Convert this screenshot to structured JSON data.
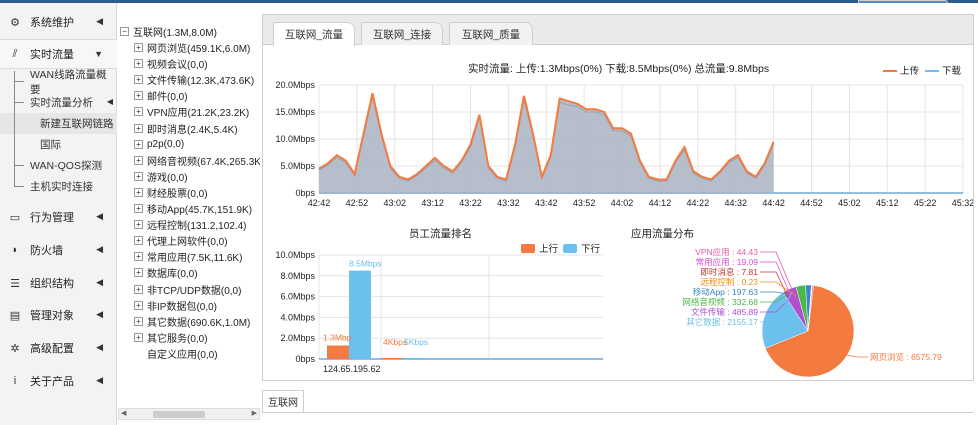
{
  "nav": {
    "items": [
      {
        "label": "系统维护",
        "icon": "dashboard-icon",
        "glyph": "⚙"
      },
      {
        "label": "实时流量",
        "icon": "chart-icon",
        "glyph": "📶"
      },
      {
        "label": "行为管理",
        "icon": "monitor-icon",
        "glyph": "▭"
      },
      {
        "label": "防火墙",
        "icon": "shield-icon",
        "glyph": "◗"
      },
      {
        "label": "组织结构",
        "icon": "list-icon",
        "glyph": "☰"
      },
      {
        "label": "管理对象",
        "icon": "table-icon",
        "glyph": "▤"
      },
      {
        "label": "高级配置",
        "icon": "gears-icon",
        "glyph": "⚙"
      },
      {
        "label": "关于产品",
        "icon": "info-icon",
        "glyph": "ℹ"
      }
    ],
    "subs": [
      "WAN线路流量概要",
      "实时流量分析",
      "新建互联网链路",
      "国际",
      "WAN-QOS探测",
      "主机实时连接"
    ]
  },
  "tree": {
    "root": "互联网(1.3M,8.0M)",
    "children": [
      "网页浏览(459.1K,6.0M)",
      "视频会议(0,0)",
      "文件传输(12.3K,473.6K)",
      "邮件(0,0)",
      "VPN应用(21.2K,23.2K)",
      "即时消息(2.4K,5.4K)",
      "p2p(0,0)",
      "网络音视频(67.4K,265.3K)",
      "游戏(0,0)",
      "财经股票(0,0)",
      "移动App(45.7K,151.9K)",
      "远程控制(131.2,102.4)",
      "代理上网软件(0,0)",
      "常用应用(7.5K,11.6K)",
      "数据库(0,0)",
      "非TCP/UDP数据(0,0)",
      "非IP数据包(0,0)",
      "其它数据(690.6K,1.0M)",
      "其它服务(0,0)"
    ],
    "custom": "自定义应用(0,0)"
  },
  "tabs": [
    "互联网_流量",
    "互联网_连接",
    "互联网_质量"
  ],
  "bottom_tab": "互联网",
  "colors": {
    "upload": "#f47b3f",
    "download": "#6cc0ee",
    "area": "#aab3c2"
  },
  "chart_data": [
    {
      "type": "area",
      "title": "实时流量: 上传:1.3Mbps(0%) 下载:8.5Mbps(0%) 总流量:9.8Mbps",
      "legend": [
        "上传",
        "下载"
      ],
      "legend_position": "top-right",
      "yticks": [
        "0bps",
        "5.0Mbps",
        "10.0Mbps",
        "15.0Mbps",
        "20.0Mbps"
      ],
      "ylim": [
        0,
        20
      ],
      "xticks": [
        "42:42",
        "42:52",
        "43:02",
        "43:12",
        "43:22",
        "43:32",
        "43:42",
        "43:52",
        "44:02",
        "44:12",
        "44:22",
        "44:32",
        "44:42",
        "44:52",
        "45:02",
        "45:12",
        "45:22",
        "45:32"
      ],
      "x": [
        0,
        2,
        4,
        6,
        8,
        10,
        12,
        14,
        16,
        18,
        20,
        22,
        24,
        26,
        28,
        30,
        32,
        34,
        36,
        38,
        40,
        42,
        44,
        46,
        48,
        50,
        52,
        54,
        56,
        58,
        60,
        62,
        64,
        66,
        68,
        70,
        72,
        74,
        76,
        78,
        80,
        82,
        84,
        86,
        88,
        90,
        92,
        94,
        96,
        98,
        100,
        102,
        104,
        106,
        108,
        110,
        112,
        114,
        116,
        118,
        120
      ],
      "series": [
        {
          "name": "上传",
          "values": [
            4.5,
            5.5,
            7,
            6,
            3.5,
            11,
            18.5,
            11,
            5,
            3,
            2.5,
            3.5,
            5,
            6.5,
            5,
            4,
            6,
            9,
            14.5,
            5,
            3,
            2.5,
            9,
            18,
            11,
            3,
            7,
            17.5,
            17,
            16.5,
            15.5,
            15.5,
            15,
            12,
            12,
            11,
            6,
            3,
            2.5,
            2.5,
            6,
            8.5,
            4,
            3,
            2.5,
            4,
            6,
            7,
            4,
            3,
            5.5,
            9.5
          ]
        },
        {
          "name": "下载",
          "values": [
            4.2,
            5.2,
            6.6,
            5.6,
            3.2,
            10.5,
            17.8,
            10.5,
            4.6,
            2.7,
            2.2,
            3.2,
            4.6,
            6,
            4.6,
            3.7,
            5.6,
            8.5,
            14,
            4.6,
            2.7,
            2.2,
            8.5,
            17.3,
            10.5,
            2.7,
            6.6,
            16.8,
            16.3,
            16,
            15,
            15,
            14.5,
            11.5,
            11.5,
            10.5,
            5.6,
            2.7,
            2.2,
            2.2,
            5.6,
            8,
            3.7,
            2.7,
            2.2,
            3.7,
            5.6,
            6.6,
            3.7,
            2.7,
            5.1,
            9
          ]
        }
      ]
    },
    {
      "type": "bar",
      "title": "员工流量排名",
      "legend": [
        "上行",
        "下行"
      ],
      "legend_position": "top-right",
      "categories": [
        "124.65.195.62",
        ""
      ],
      "yticks": [
        "0bps",
        "2.0Mbps",
        "4.0Mbps",
        "6.0Mbps",
        "8.0Mbps",
        "10.0Mbps"
      ],
      "ylim": [
        0,
        10
      ],
      "series": [
        {
          "name": "上行",
          "values": [
            1.3,
            0.004
          ],
          "labels": [
            "1.3Mbp",
            "4Kbps"
          ]
        },
        {
          "name": "下行",
          "values": [
            8.5,
            0.005
          ],
          "labels": [
            "8.5Mbps",
            "5Kbps"
          ]
        }
      ]
    },
    {
      "type": "pie",
      "title": "应用流量分布",
      "slices": [
        {
          "label": "网页浏览 : 6575.79",
          "value": 6575.79,
          "color": "#f47b3f"
        },
        {
          "label": "其它数据 : 2155.17",
          "value": 2155.17,
          "color": "#6cc0ee"
        },
        {
          "label": "文件传输 : 485.89",
          "value": 485.89,
          "color": "#b04fd0"
        },
        {
          "label": "网络音视频 : 332.68",
          "value": 332.68,
          "color": "#4cb84c"
        },
        {
          "label": "移动App : 197.63",
          "value": 197.63,
          "color": "#3a87c8"
        },
        {
          "label": "远程控制 : 0.23",
          "value": 0.23,
          "color": "#f08c1a"
        },
        {
          "label": "即时消息 : 7.81",
          "value": 7.81,
          "color": "#c0392b"
        },
        {
          "label": "常用应用 : 19.09",
          "value": 19.09,
          "color": "#d54ed0"
        },
        {
          "label": "VPN应用 : 44.43",
          "value": 44.43,
          "color": "#e85aa8"
        }
      ]
    }
  ]
}
